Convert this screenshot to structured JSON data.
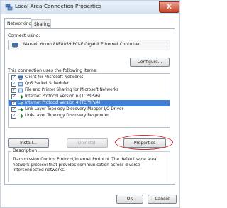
{
  "window": {
    "title": "Local Area Connection Properties",
    "close_label": "X"
  },
  "tabs": [
    {
      "label": "Networking",
      "active": true
    },
    {
      "label": "Sharing",
      "active": false
    }
  ],
  "connect_using": {
    "label": "Connect using:",
    "adapter": "Marvell Yukon 88E8059 PCI-E Gigabit Ethernet Controller"
  },
  "configure_label": "Configure...",
  "items_label": "This connection uses the following items:",
  "items": [
    {
      "label": "Client for Microsoft Networks",
      "checked": true,
      "icon": "network-client-icon",
      "selected": false
    },
    {
      "label": "QoS Packet Scheduler",
      "checked": true,
      "icon": "network-service-icon",
      "selected": false
    },
    {
      "label": "File and Printer Sharing for Microsoft Networks",
      "checked": true,
      "icon": "network-service-icon",
      "selected": false
    },
    {
      "label": "Internet Protocol Version 6 (TCP/IPv6)",
      "checked": true,
      "icon": "protocol-icon",
      "selected": false
    },
    {
      "label": "Internet Protocol Version 4 (TCP/IPv4)",
      "checked": true,
      "icon": "protocol-icon",
      "selected": true
    },
    {
      "label": "Link-Layer Topology Discovery Mapper I/O Driver",
      "checked": true,
      "icon": "protocol-icon",
      "selected": false
    },
    {
      "label": "Link-Layer Topology Discovery Responder",
      "checked": true,
      "icon": "protocol-icon",
      "selected": false
    }
  ],
  "buttons": {
    "install": "Install...",
    "uninstall": "Uninstall",
    "properties": "Properties",
    "ok": "OK",
    "cancel": "Cancel"
  },
  "description": {
    "title": "Description",
    "text": "Transmission Control Protocol/Internet Protocol. The default wide area network protocol that provides communication across diverse interconnected networks."
  },
  "colors": {
    "selection": "#3f7fd8",
    "annotation": "#d0242e"
  }
}
